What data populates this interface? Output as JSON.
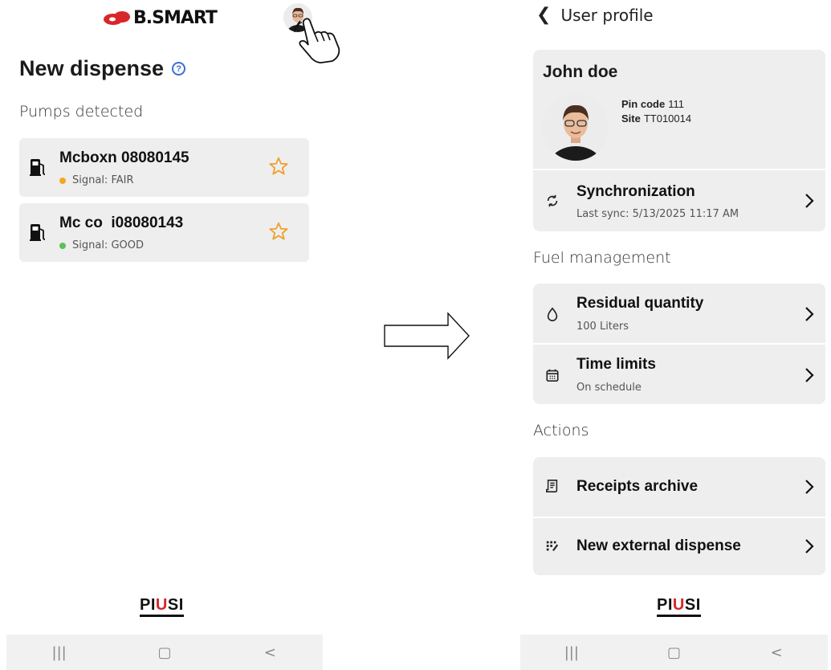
{
  "left_screen": {
    "logo_text": "B.SMART",
    "title": "New dispense",
    "subtitle": "Pumps detected",
    "pumps": [
      {
        "name": "Mcboxn 08080145",
        "signal": "Signal: FAIR",
        "signal_color": "#f5a623"
      },
      {
        "name": "Mc co  i08080143",
        "signal": "Signal: GOOD",
        "signal_color": "#5cc15c"
      }
    ],
    "footer_brand": {
      "pre": "PI",
      "mid": "U",
      "post": "SI"
    },
    "nav": [
      "|||",
      "▢",
      "<"
    ]
  },
  "right_screen": {
    "back_title": "User profile",
    "profile": {
      "name": "John doe",
      "pin_label": "Pin code",
      "pin_value": "111",
      "site_label": "Site",
      "site_value": "TT010014"
    },
    "sync": {
      "title": "Synchronization",
      "subtitle": "Last sync: 5/13/2025 11:17 AM"
    },
    "fuel_section": "Fuel management",
    "residual": {
      "title": "Residual quantity",
      "subtitle": "100 Liters"
    },
    "time_limits": {
      "title": "Time limits",
      "subtitle": "On schedule"
    },
    "actions_section": "Actions",
    "receipts": {
      "title": "Receipts archive"
    },
    "external": {
      "title": "New external dispense"
    },
    "footer_brand": {
      "pre": "PI",
      "mid": "U",
      "post": "SI"
    },
    "nav": [
      "|||",
      "▢",
      "<"
    ]
  },
  "colors": {
    "accent_red": "#d8262b",
    "help_blue": "#3b6fd6",
    "star_orange": "#f0a030",
    "card_bg": "#eeeeee"
  }
}
